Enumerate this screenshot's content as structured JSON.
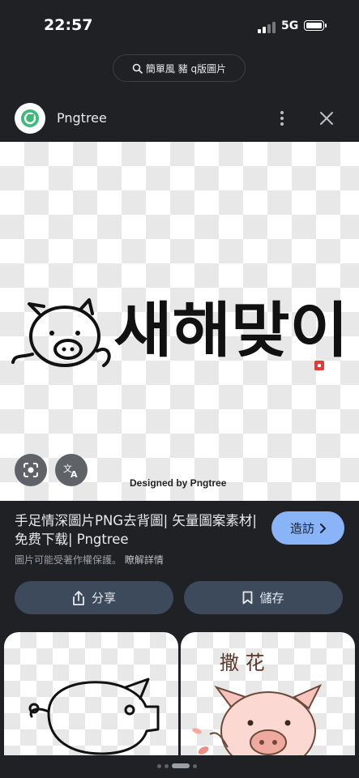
{
  "status": {
    "time": "22:57",
    "network": "5G"
  },
  "search": {
    "query": "簡單風 豬 q版圖片"
  },
  "site": {
    "name": "Pngtree"
  },
  "image": {
    "hangul_text": "새해맞이",
    "watermark": "Designed by Pngtree"
  },
  "result": {
    "title": "手足情深圖片PNG去背圖| 矢量圖案素材| 免费下载| Pngtree",
    "visit_label": "造訪",
    "copyright_notice": "圖片可能受著作權保護。",
    "learn_more": "瞭解詳情"
  },
  "actions": {
    "share_label": "分享",
    "save_label": "儲存"
  },
  "related": [
    {
      "text": "撒 花"
    }
  ],
  "icons": {
    "search": "search-icon",
    "more": "more-vert-icon",
    "close": "close-icon",
    "lens": "lens-icon",
    "translate": "translate-icon",
    "share": "share-icon",
    "bookmark": "bookmark-icon",
    "chevron": "chevron-right-icon"
  },
  "colors": {
    "background": "#202124",
    "accent": "#8ab4f8",
    "button": "#3c4a5c",
    "brand_green": "#3cba7a"
  }
}
